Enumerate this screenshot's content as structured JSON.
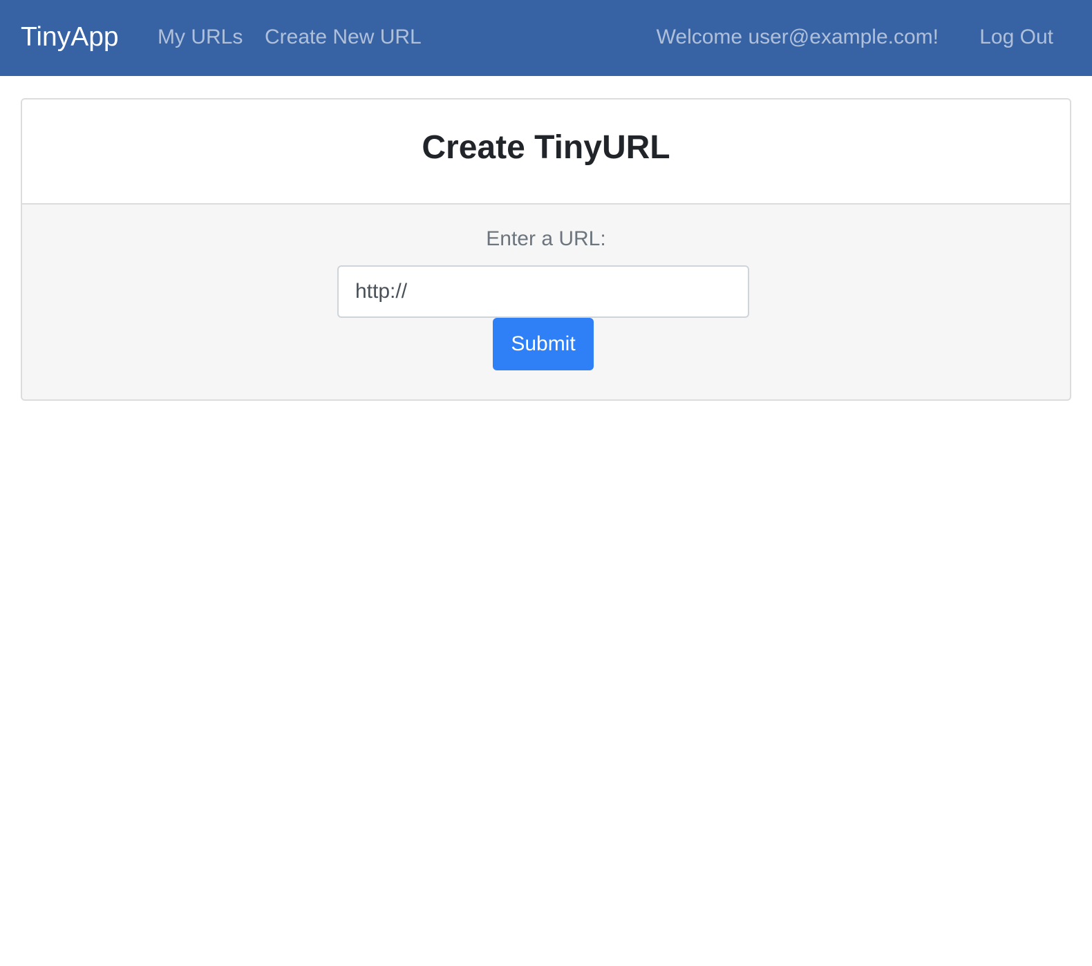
{
  "navbar": {
    "brand": "TinyApp",
    "links": [
      {
        "label": "My URLs"
      },
      {
        "label": "Create New URL"
      }
    ],
    "welcome": "Welcome user@example.com!",
    "logout": "Log Out",
    "background_color": "#3763a5"
  },
  "card": {
    "title": "Create TinyURL",
    "form": {
      "label": "Enter a URL:",
      "input_value": "http://",
      "submit_label": "Submit",
      "submit_color": "#2f7ff7"
    }
  }
}
